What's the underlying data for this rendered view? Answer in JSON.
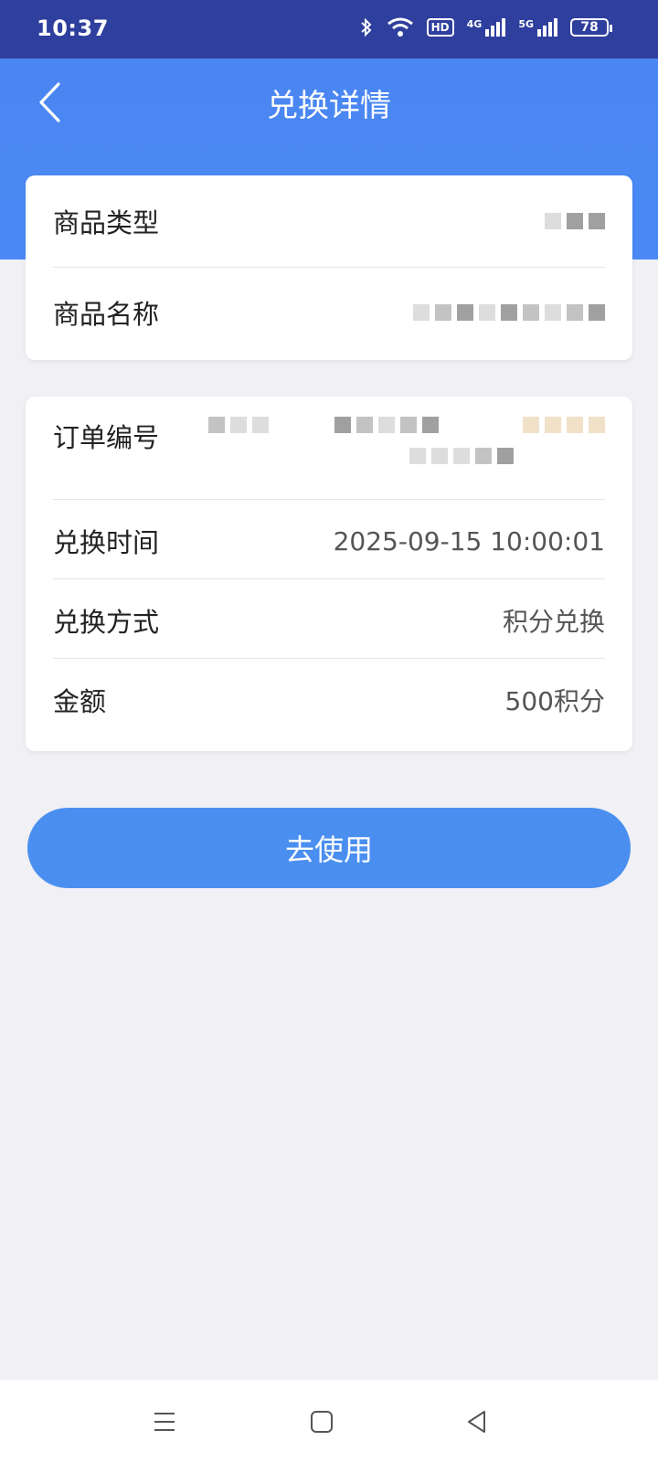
{
  "status": {
    "time": "10:37",
    "battery": "78",
    "icons": [
      "bluetooth-icon",
      "wifi-icon",
      "hd-icon",
      "signal-4g-icon",
      "signal-5g-icon",
      "battery-icon"
    ],
    "hd_label": "HD",
    "net_4g": "4G",
    "net_5g": "5G"
  },
  "header": {
    "title": "兑换详情"
  },
  "product": {
    "type_label": "商品类型",
    "name_label": "商品名称"
  },
  "order": {
    "number_label": "订单编号",
    "time_label": "兑换时间",
    "time_value": "2025-09-15 10:00:01",
    "method_label": "兑换方式",
    "method_value": "积分兑换",
    "amount_label": "金额",
    "amount_value": "500积分"
  },
  "action": {
    "use_label": "去使用"
  },
  "colors": {
    "status_bar": "#2f3f9e",
    "header": "#4a86f2",
    "button": "#4a8ff0",
    "background": "#f0f0f5"
  }
}
